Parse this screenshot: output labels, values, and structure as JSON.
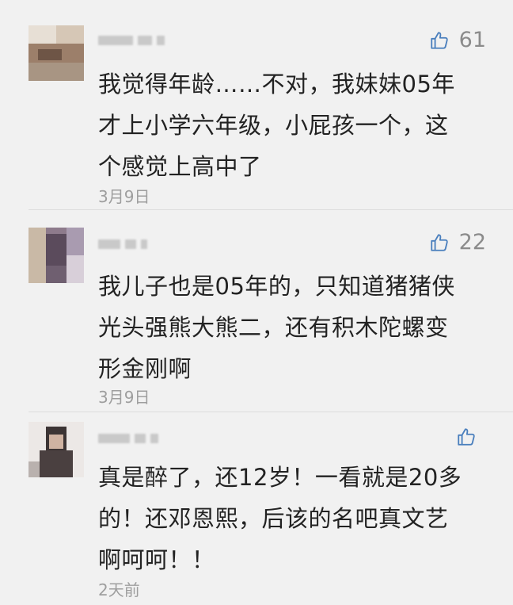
{
  "comments": [
    {
      "likes": "61",
      "text_lines": [
        "我觉得年龄……不对，我妹妹05年",
        "才上小学六年级，小屁孩一个，这",
        "个感觉上高中了"
      ],
      "date": "3月9日"
    },
    {
      "likes": "22",
      "text_lines": [
        "我儿子也是05年的，只知道猪猪侠",
        "光头强熊大熊二，还有积木陀螺变",
        "形金刚啊"
      ],
      "date": "3月9日"
    },
    {
      "likes": "",
      "text_lines": [
        "真是醉了，还12岁！一看就是20多",
        "的！还邓恩熙，后该的名吧真文艺",
        "啊呵呵！！"
      ],
      "date": "2天前"
    }
  ],
  "colors": {
    "background": "#f1f1f1",
    "text": "#222222",
    "muted": "#9e9e9e",
    "like": "#8b8b8b"
  },
  "icons": {
    "like": "thumbs-up-icon"
  }
}
